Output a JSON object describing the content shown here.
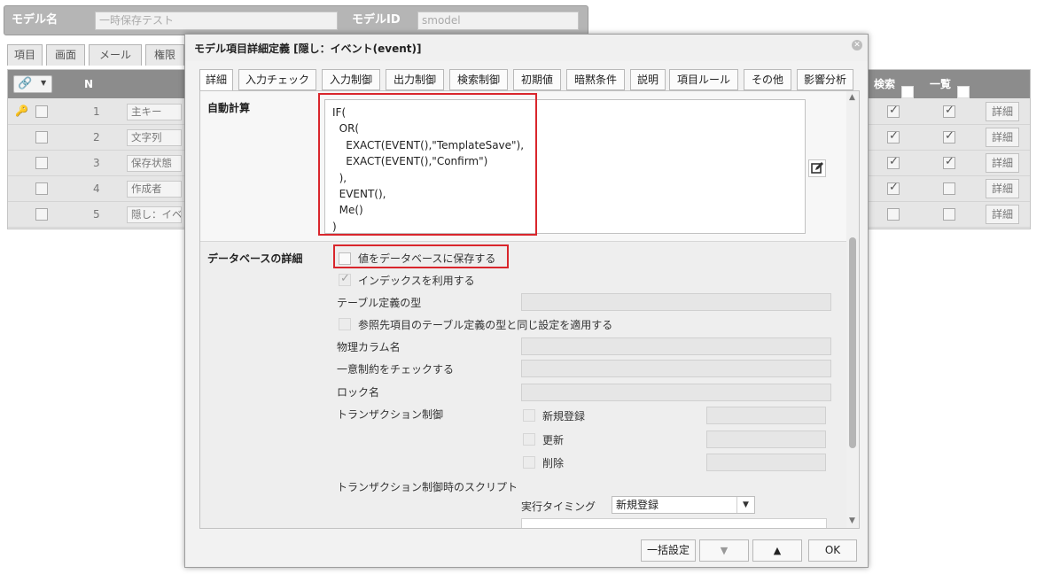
{
  "background": {
    "model_name_label": "モデル名",
    "model_name_value": "一時保存テスト",
    "model_id_label": "モデルID",
    "model_id_value": "smodel",
    "tabs": [
      "項目",
      "画面",
      "メール",
      "権限"
    ],
    "grid": {
      "col_n": "N",
      "col_search": "検索",
      "col_list": "一覧",
      "detail_label": "詳細",
      "rows": [
        {
          "n": "1",
          "name": "主キー",
          "search": true,
          "list": true,
          "key": true
        },
        {
          "n": "2",
          "name": "文字列",
          "search": true,
          "list": true,
          "key": false
        },
        {
          "n": "3",
          "name": "保存状態",
          "search": true,
          "list": true,
          "key": false
        },
        {
          "n": "4",
          "name": "作成者",
          "search": true,
          "list": false,
          "key": false
        },
        {
          "n": "5",
          "name": "隠し：イベ",
          "search": false,
          "list": false,
          "key": false
        }
      ]
    }
  },
  "dialog": {
    "title": "モデル項目詳細定義 [隠し：イベント(event)]",
    "tabs": [
      "詳細",
      "入力チェック",
      "入力制御",
      "出力制御",
      "検索制御",
      "初期値",
      "暗黙条件",
      "説明",
      "項目ルール",
      "その他",
      "影響分析"
    ],
    "active_tab": "詳細",
    "auto_calc": {
      "label": "自動計算",
      "formula": "IF(\n  OR(\n    EXACT(EVENT(),\"TemplateSave\"),\n    EXACT(EVENT(),\"Confirm\")\n  ),\n  EVENT(),\n  Me()\n)"
    },
    "db": {
      "section_label": "データベースの詳細",
      "save_to_db_label": "値をデータベースに保存する",
      "save_to_db_checked": false,
      "use_index_label": "インデックスを利用する",
      "use_index_checked": true,
      "table_type_label": "テーブル定義の型",
      "apply_ref_type_label": "参照先項目のテーブル定義の型と同じ設定を適用する",
      "physical_column_label": "物理カラム名",
      "unique_check_label": "一意制約をチェックする",
      "lock_name_label": "ロック名",
      "transaction_label": "トランザクション制御",
      "transaction_options": [
        "新規登録",
        "更新",
        "削除"
      ],
      "transaction_script_label": "トランザクション制御時のスクリプト",
      "timing_label": "実行タイミング",
      "timing_value": "新規登録"
    },
    "footer": {
      "bulk_label": "一括設定",
      "down_label": "▼",
      "up_label": "▲",
      "ok_label": "OK"
    }
  },
  "colors": {
    "highlight": "#d9262c",
    "grid_header": "#8c8c8c",
    "topbar": "#b5b5b5"
  }
}
